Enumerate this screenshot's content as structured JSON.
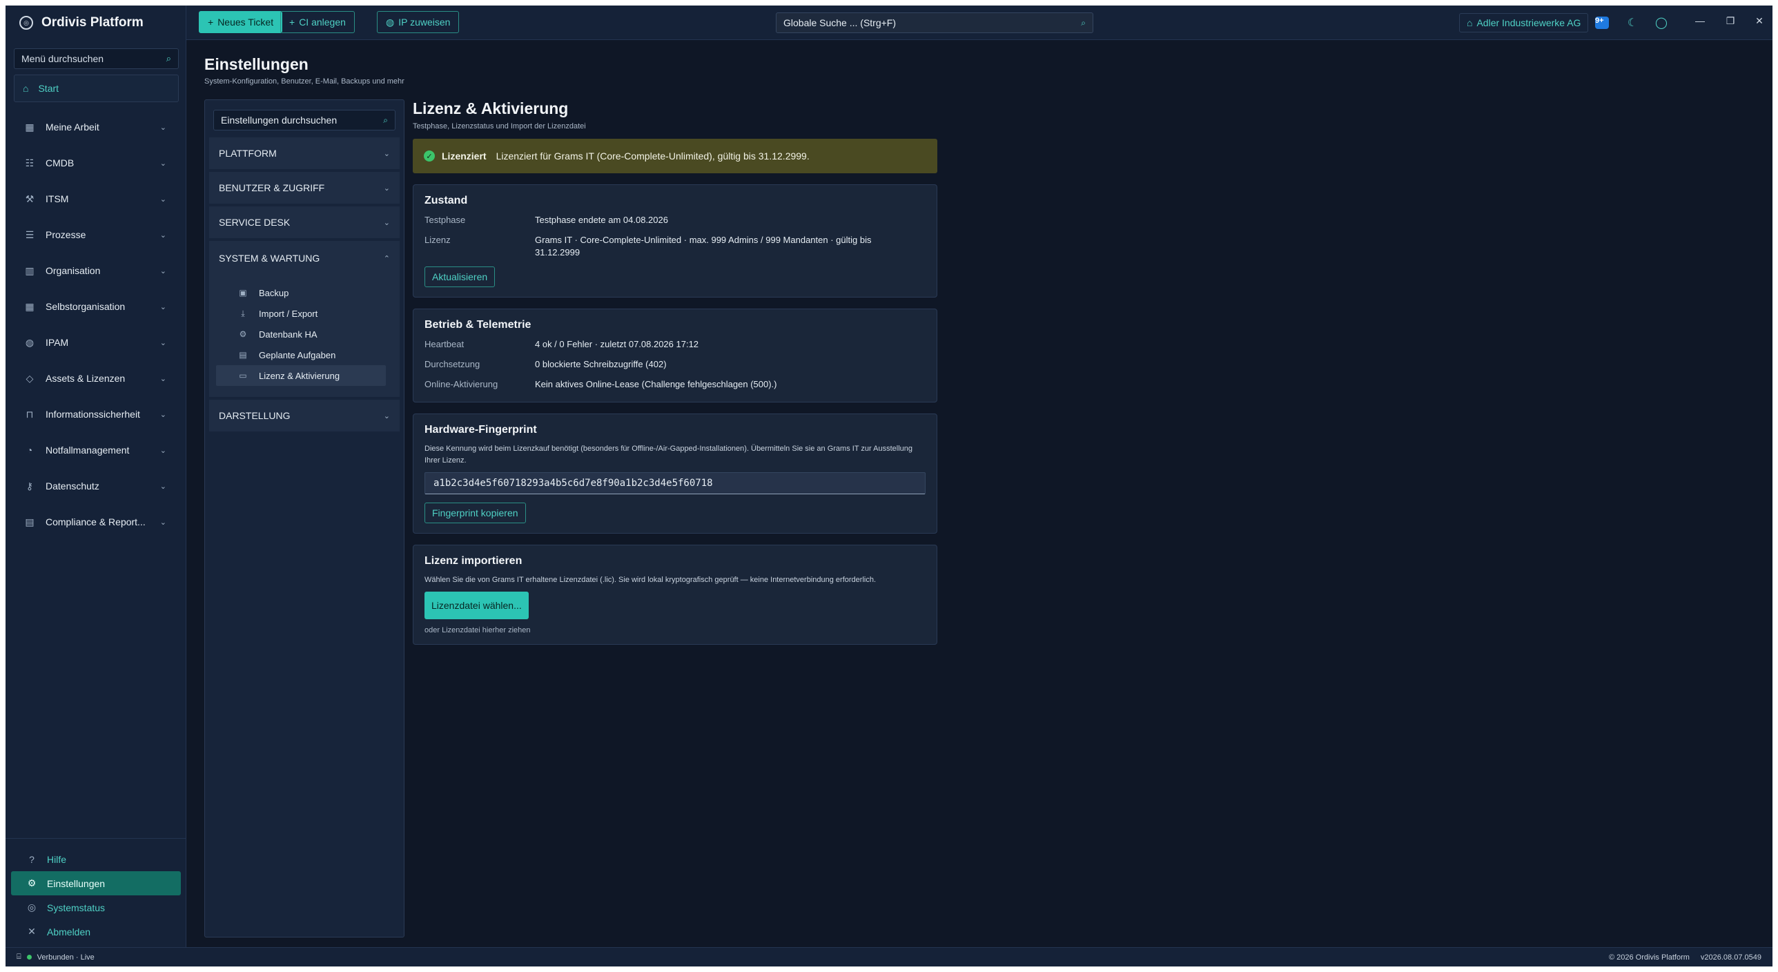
{
  "brand": {
    "title": "Ordivis Platform"
  },
  "sidebar": {
    "search_placeholder": "Menü durchsuchen",
    "start_label": "Start",
    "items": [
      {
        "label": "Meine Arbeit",
        "icon": "calendar-icon"
      },
      {
        "label": "CMDB",
        "icon": "list-icon"
      },
      {
        "label": "ITSM",
        "icon": "wrench-icon"
      },
      {
        "label": "Prozesse",
        "icon": "process-list-icon"
      },
      {
        "label": "Organisation",
        "icon": "building-icon"
      },
      {
        "label": "Selbstorganisation",
        "icon": "calendar-icon"
      },
      {
        "label": "IPAM",
        "icon": "globe-icon"
      },
      {
        "label": "Assets & Lizenzen",
        "icon": "tag-icon"
      },
      {
        "label": "Informationssicherheit",
        "icon": "lock-icon"
      },
      {
        "label": "Notfallmanagement",
        "icon": "bell-icon"
      },
      {
        "label": "Datenschutz",
        "icon": "key-icon"
      },
      {
        "label": "Compliance & Report...",
        "icon": "report-icon"
      }
    ],
    "bottom": {
      "help": "Hilfe",
      "settings": "Einstellungen",
      "status": "Systemstatus",
      "logout": "Abmelden"
    }
  },
  "topbar": {
    "new_ticket": "Neues Ticket",
    "new_ci": "CI anlegen",
    "assign_ip": "IP zuweisen",
    "search_placeholder": "Globale Suche ... (Strg+F)",
    "org": "Adler Industriewerke AG",
    "badge": "9+"
  },
  "page": {
    "title": "Einstellungen",
    "subtitle": "System-Konfiguration, Benutzer, E-Mail, Backups und mehr"
  },
  "settings_nav": {
    "search_placeholder": "Einstellungen durchsuchen",
    "sections": {
      "platform": "PLATTFORM",
      "users": "BENUTZER & ZUGRIFF",
      "service": "SERVICE DESK",
      "system": "SYSTEM & WARTUNG",
      "display": "DARSTELLUNG"
    },
    "system_items": [
      {
        "label": "Backup",
        "icon": "backup-icon"
      },
      {
        "label": "Import / Export",
        "icon": "download-icon"
      },
      {
        "label": "Datenbank HA",
        "icon": "database-icon"
      },
      {
        "label": "Geplante Aufgaben",
        "icon": "calendar-icon"
      },
      {
        "label": "Lizenz & Aktivierung",
        "icon": "license-icon"
      }
    ]
  },
  "license": {
    "title": "Lizenz & Aktivierung",
    "subtitle": "Testphase, Lizenzstatus und Import der Lizenzdatei",
    "banner_status": "Lizenziert",
    "banner_text": "Lizenziert für Grams IT (Core-Complete-Unlimited), gültig bis 31.12.2999.",
    "state": {
      "title": "Zustand",
      "trial_label": "Testphase",
      "trial_value": "Testphase endete am 04.08.2026",
      "license_label": "Lizenz",
      "license_value": "Grams IT · Core-Complete-Unlimited · max. 999 Admins / 999 Mandanten · gültig bis 31.12.2999",
      "refresh_button": "Aktualisieren"
    },
    "telemetry": {
      "title": "Betrieb & Telemetrie",
      "heartbeat_label": "Heartbeat",
      "heartbeat_value": "4 ok / 0 Fehler · zuletzt 07.08.2026 17:12",
      "enforcement_label": "Durchsetzung",
      "enforcement_value": "0 blockierte Schreibzugriffe (402)",
      "online_label": "Online-Aktivierung",
      "online_value": "Kein aktives Online-Lease (Challenge fehlgeschlagen (500).)"
    },
    "fingerprint": {
      "title": "Hardware-Fingerprint",
      "description": "Diese Kennung wird beim Lizenzkauf benötigt (besonders für Offline-/Air-Gapped-Installationen). Übermitteln Sie sie an Grams IT zur Ausstellung Ihrer Lizenz.",
      "value": "a1b2c3d4e5f60718293a4b5c6d7e8f90a1b2c3d4e5f60718",
      "copy_button": "Fingerprint kopieren"
    },
    "import": {
      "title": "Lizenz importieren",
      "description": "Wählen Sie die von Grams IT erhaltene Lizenzdatei (.lic). Sie wird lokal kryptografisch geprüft — keine Internetverbindung erforderlich.",
      "choose_button": "Lizenzdatei wählen...",
      "drop_hint": "oder Lizenzdatei hierher ziehen"
    }
  },
  "statusbar": {
    "connection": "Verbunden · Live",
    "copyright": "© 2026 Ordivis Platform",
    "version": "v2026.08.07.0549"
  },
  "colors": {
    "accent": "#2cc4b4",
    "background": "#0f1726",
    "sidebar": "#152238",
    "banner": "#4a4a22",
    "success": "#3cc46a"
  }
}
